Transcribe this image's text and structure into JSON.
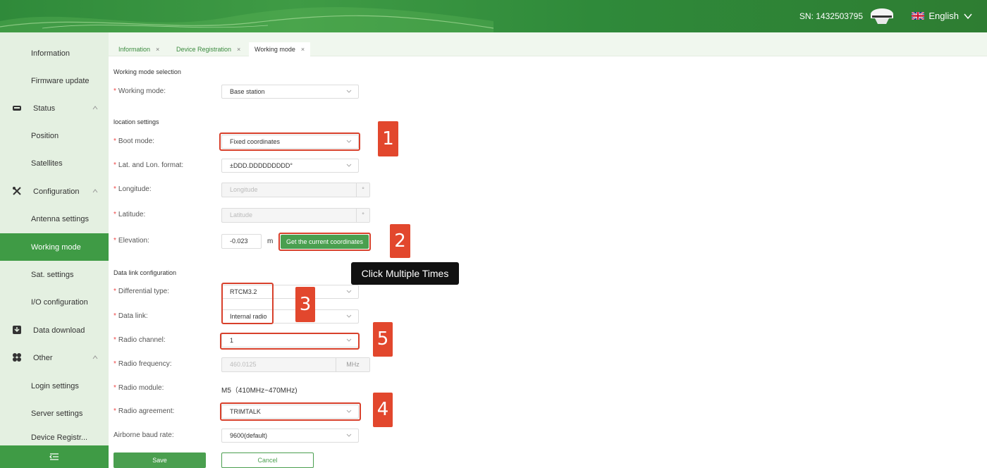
{
  "header": {
    "sn_label": "SN: 1432503795",
    "language": "English"
  },
  "sidebar": {
    "items": [
      {
        "label": "Information"
      },
      {
        "label": "Firmware update"
      },
      {
        "label": "Status"
      },
      {
        "label": "Position"
      },
      {
        "label": "Satellites"
      },
      {
        "label": "Configuration"
      },
      {
        "label": "Antenna settings"
      },
      {
        "label": "Working mode"
      },
      {
        "label": "Sat. settings"
      },
      {
        "label": "I/O configuration"
      },
      {
        "label": "Data download"
      },
      {
        "label": "Other"
      },
      {
        "label": "Login settings"
      },
      {
        "label": "Server settings"
      },
      {
        "label": "Device Registr..."
      }
    ]
  },
  "tabs": [
    {
      "label": "Information"
    },
    {
      "label": "Device Registration"
    },
    {
      "label": "Working mode"
    }
  ],
  "tab_close": "×",
  "required": "*",
  "form": {
    "section_working_mode": "Working mode selection",
    "working_mode_label": "Working mode:",
    "working_mode_value": "Base station",
    "section_location": "location settings",
    "boot_mode_label": "Boot mode:",
    "boot_mode_value": "Fixed coordinates",
    "latlon_format_label": "Lat. and Lon. format:",
    "latlon_format_value": "±DDD.DDDDDDDDD°",
    "longitude_label": "Longitude:",
    "longitude_placeholder": "Longitude",
    "latitude_label": "Latitude:",
    "latitude_placeholder": "Latitude",
    "degree_suffix": "°",
    "elevation_label": "Elevation:",
    "elevation_value": "-0.023",
    "elevation_unit": "m",
    "get_coords_button": "Get the current coordinates",
    "section_datalink": "Data link configuration",
    "diff_type_label": "Differential type:",
    "diff_type_value": "RTCM3.2",
    "data_link_label": "Data link:",
    "data_link_value": "Internal radio",
    "radio_channel_label": "Radio channel:",
    "radio_channel_value": "1",
    "radio_freq_label": "Radio frequency:",
    "radio_freq_value": "460.0125",
    "radio_freq_unit": "MHz",
    "radio_module_label": "Radio module:",
    "radio_module_value": "M5（410MHz~470MHz)",
    "radio_agreement_label": "Radio agreement:",
    "radio_agreement_value": "TRIMTALK",
    "baud_rate_label": "Airborne baud rate:",
    "baud_rate_value": "9600(default)",
    "save_button": "Save",
    "cancel_button": "Cancel"
  },
  "annotations": {
    "badge_1": "1",
    "badge_2": "2",
    "badge_3": "3",
    "badge_4": "4",
    "badge_5": "5",
    "tooltip": "Click Multiple Times"
  },
  "colors": {
    "primary_green": "#3f9b45",
    "annotation_red": "#e2472d",
    "sidebar_bg": "#e4f0e1"
  }
}
